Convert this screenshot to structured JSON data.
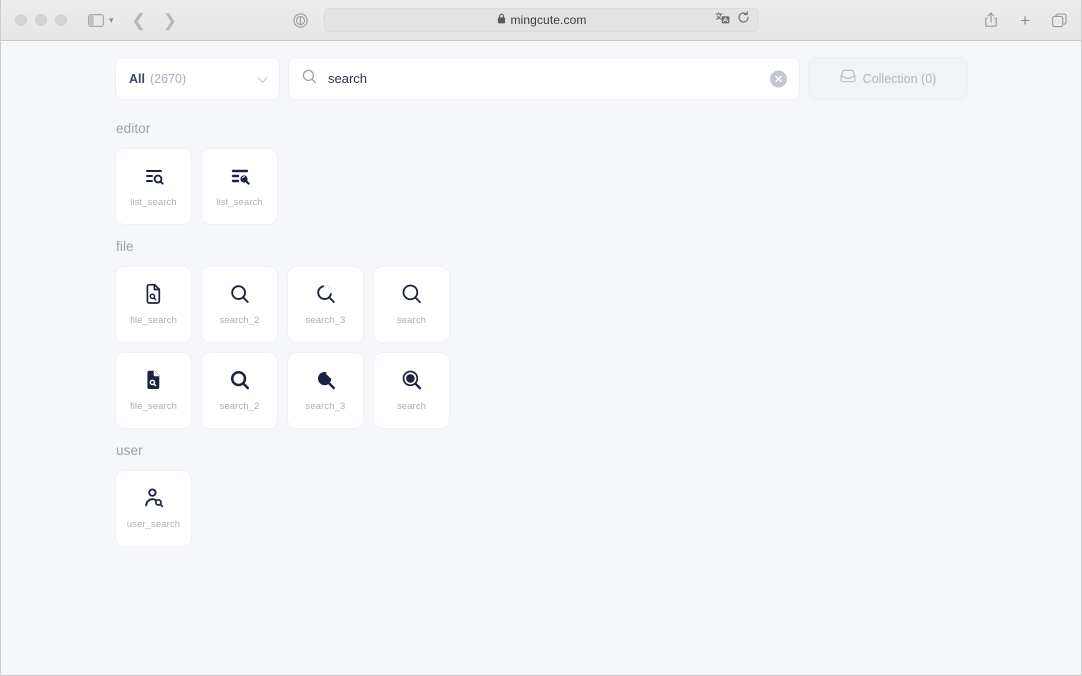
{
  "browser": {
    "url": "mingcute.com",
    "lock_icon": "lock-icon",
    "sidebar_icon": "sidebar-toggle-icon",
    "back_icon": "back-arrow-icon",
    "forward_icon": "forward-arrow-icon",
    "shield_icon": "privacy-shield-icon",
    "pocket_icon": "pocket-icon",
    "translate_icon": "translate-icon",
    "reload_icon": "reload-icon",
    "share_icon": "share-icon",
    "new_tab_icon": "plus-icon",
    "tab_overview_icon": "tab-overview-icon"
  },
  "toolbar": {
    "filter_label": "All",
    "filter_count": "(2670)",
    "search_value": "search",
    "search_placeholder": "search",
    "search_icon": "search-icon",
    "clear_icon": "clear-circle-icon",
    "collection_label": "Collection (0)",
    "collection_icon": "inbox-icon"
  },
  "sections": [
    {
      "title": "editor",
      "icons": [
        {
          "label": "list_search",
          "glyph": "list-search-line-icon"
        },
        {
          "label": "list_search",
          "glyph": "list-search-fill-icon"
        }
      ]
    },
    {
      "title": "file",
      "icons": [
        {
          "label": "file_search",
          "glyph": "file-search-line-icon"
        },
        {
          "label": "search_2",
          "glyph": "search-2-line-icon"
        },
        {
          "label": "search_3",
          "glyph": "search-3-line-icon"
        },
        {
          "label": "search",
          "glyph": "search-line-icon"
        },
        {
          "label": "file_search",
          "glyph": "file-search-fill-icon"
        },
        {
          "label": "search_2",
          "glyph": "search-2-fill-icon"
        },
        {
          "label": "search_3",
          "glyph": "search-3-fill-icon"
        },
        {
          "label": "search",
          "glyph": "search-fill-icon"
        }
      ]
    },
    {
      "title": "user",
      "icons": [
        {
          "label": "user_search",
          "glyph": "user-search-line-icon"
        }
      ]
    }
  ],
  "colors": {
    "page_bg": "#f6f7fa",
    "card_bg": "#ffffff",
    "icon_dark": "#1c2340",
    "label_grey": "#a9aebb",
    "section_grey": "#9ba0ad"
  }
}
